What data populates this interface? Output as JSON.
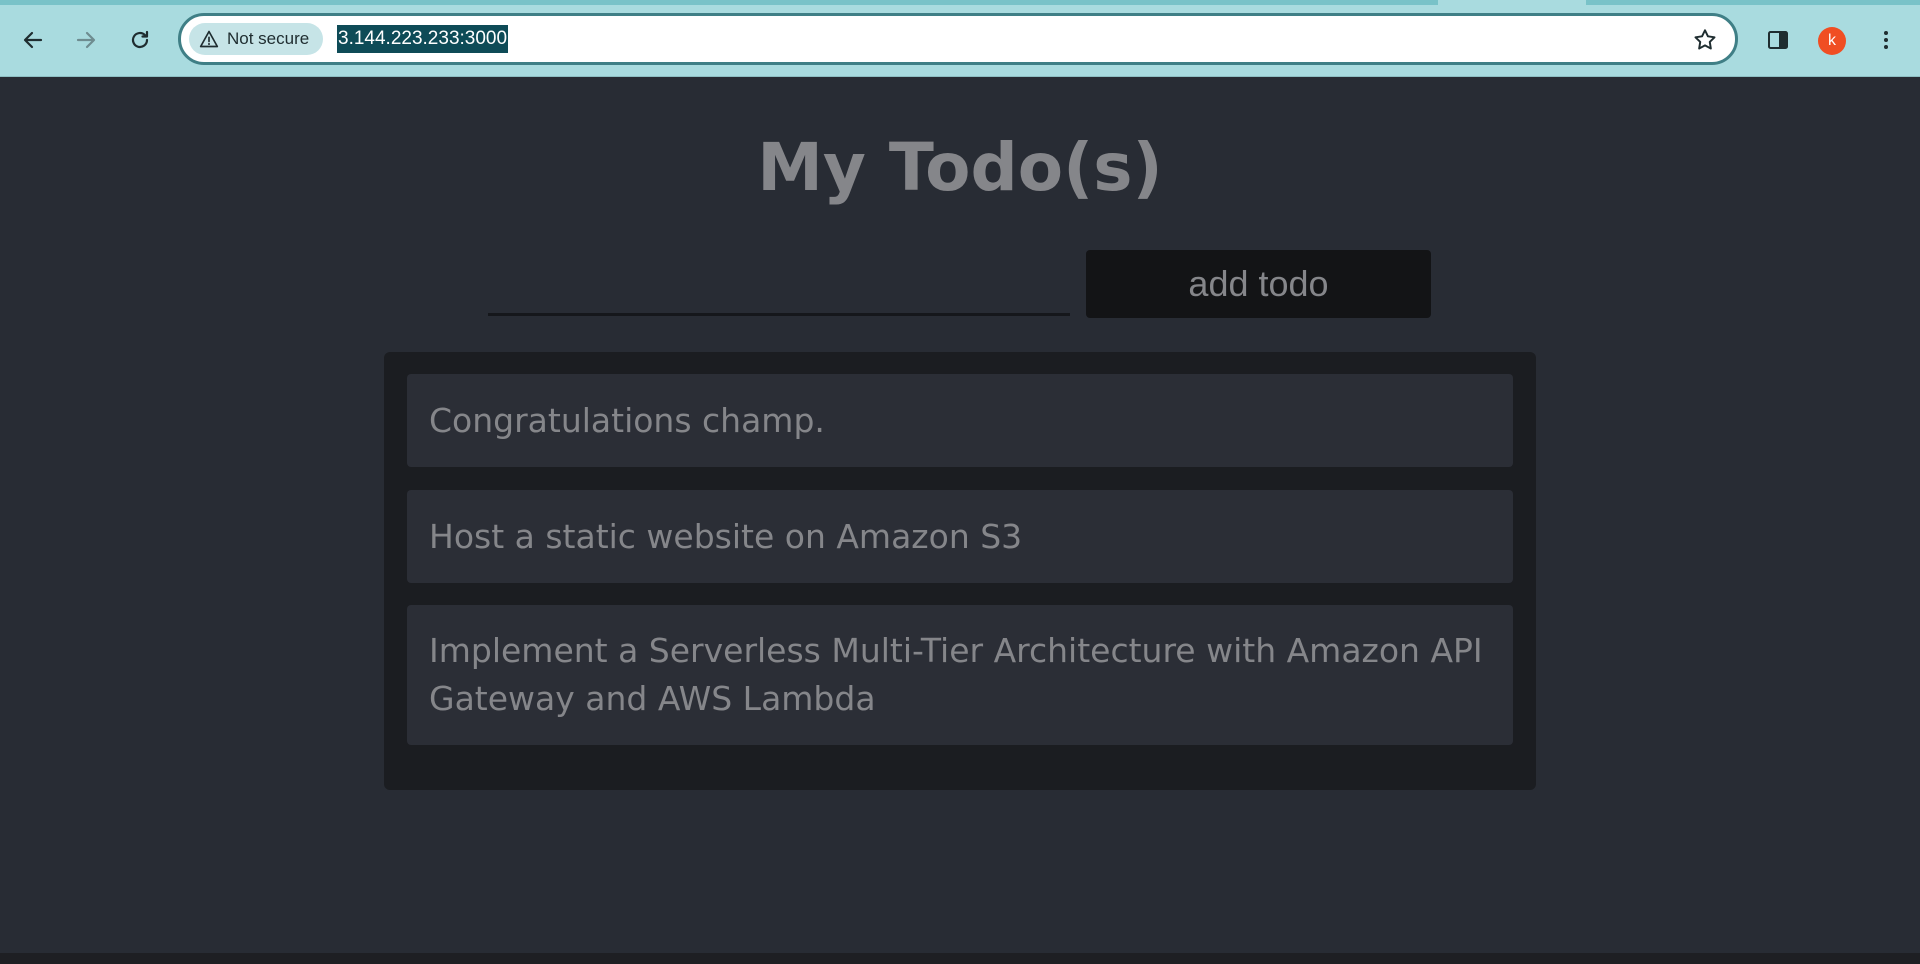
{
  "browser": {
    "security_label": "Not secure",
    "url": "3.144.223.233:3000",
    "profile_initial": "k",
    "icons": {
      "back": "arrow-left-icon",
      "forward": "arrow-right-icon",
      "reload": "reload-icon",
      "security": "warning-triangle-icon",
      "bookmark": "star-icon",
      "side_panel": "side-panel-icon",
      "menu": "kebab-menu-icon"
    },
    "colors": {
      "toolbar": "#a9dbdf",
      "omnibox_border": "#3f7f86",
      "url_highlight": "#0e4b57",
      "avatar": "#f04e23"
    }
  },
  "app": {
    "title": "My Todo(s)",
    "input": {
      "value": "",
      "placeholder": ""
    },
    "add_button_label": "add todo",
    "todos": [
      {
        "text": "Congratulations champ."
      },
      {
        "text": "Host a static website on Amazon S3"
      },
      {
        "text": "Implement a Serverless Multi-Tier Architecture with Amazon API Gateway and AWS Lambda"
      }
    ],
    "colors": {
      "background": "#282c34",
      "panel": "#1b1d21",
      "item": "#2b2e36",
      "text": "#85868a"
    }
  }
}
